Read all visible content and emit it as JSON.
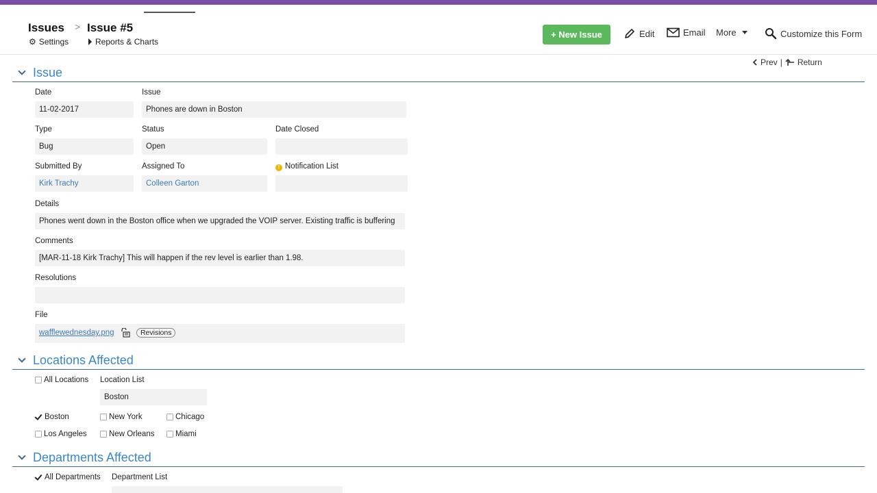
{
  "header": {
    "breadcrumb_root": "Issues",
    "breadcrumb_sep": ">",
    "breadcrumb_current": "Issue #5",
    "settings_label": "Settings",
    "reports_label": "Reports & Charts"
  },
  "toolbar": {
    "new_issue_label": "+ New Issue",
    "edit_label": "Edit",
    "email_label": "Email",
    "more_label": "More",
    "customize_label": "Customize this Form",
    "accent_color": "#5cb85c"
  },
  "nav": {
    "prev_label": "Prev",
    "separator": "|",
    "return_label": "Return"
  },
  "sections": {
    "issue": "Issue",
    "locations": "Locations Affected",
    "departments": "Departments Affected"
  },
  "issue": {
    "date_label": "Date",
    "date_value": "11-02-2017",
    "issue_label": "Issue",
    "issue_value": "Phones are down in Boston",
    "type_label": "Type",
    "type_value": "Bug",
    "status_label": "Status",
    "status_value": "Open",
    "date_closed_label": "Date Closed",
    "date_closed_value": "",
    "submitted_by_label": "Submitted By",
    "submitted_by_value": "Kirk Trachy",
    "assigned_to_label": "Assigned To",
    "assigned_to_value": "Colleen Garton",
    "notification_label": "Notification List",
    "notification_value": "",
    "details_label": "Details",
    "details_value": "Phones went down in the Boston office when we upgraded the VOIP server.  Existing traffic is buffering",
    "comments_label": "Comments",
    "comments_value": "[MAR-11-18 Kirk Trachy] This will happen if the rev level is earlier than 1.98.",
    "resolutions_label": "Resolutions",
    "resolutions_value": "",
    "file_label": "File",
    "file_name": "wafflewednesday.png",
    "revisions_label": "Revisions"
  },
  "locations": {
    "all_label": "All Locations",
    "all_checked": false,
    "list_label": "Location List",
    "list_value": "Boston",
    "options": [
      {
        "label": "Boston",
        "checked": true
      },
      {
        "label": "New York",
        "checked": false
      },
      {
        "label": "Chicago",
        "checked": false
      },
      {
        "label": "Los Angeles",
        "checked": false
      },
      {
        "label": "New Orleans",
        "checked": false
      },
      {
        "label": "Miami",
        "checked": false
      }
    ]
  },
  "departments": {
    "all_label": "All Departments",
    "all_checked": true,
    "list_label": "Department List"
  },
  "colors": {
    "top_bar": "#7b4fa8",
    "section_title": "#3c86c8",
    "link": "#3c7ab8"
  }
}
